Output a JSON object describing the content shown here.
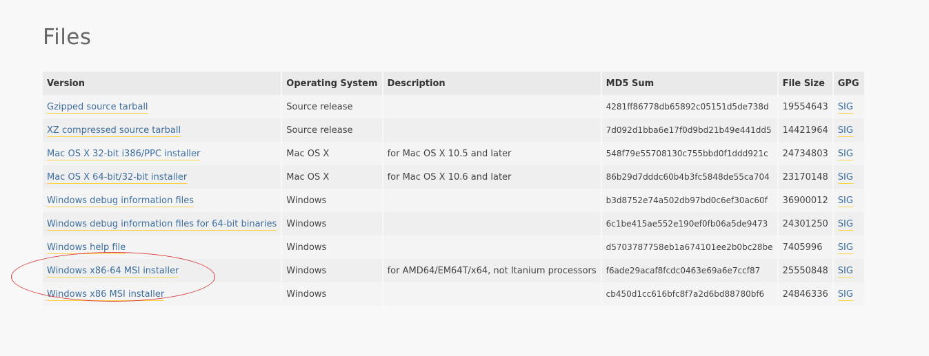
{
  "page": {
    "title": "Files"
  },
  "table": {
    "headers": {
      "version": "Version",
      "os": "Operating System",
      "description": "Description",
      "md5": "MD5 Sum",
      "size": "File Size",
      "gpg": "GPG"
    },
    "rows": [
      {
        "version": "Gzipped source tarball",
        "os": "Source release",
        "description": "",
        "md5": "4281ff86778db65892c05151d5de738d",
        "size": "19554643",
        "gpg": "SIG"
      },
      {
        "version": "XZ compressed source tarball",
        "os": "Source release",
        "description": "",
        "md5": "7d092d1bba6e17f0d9bd21b49e441dd5",
        "size": "14421964",
        "gpg": "SIG"
      },
      {
        "version": "Mac OS X 32-bit i386/PPC installer",
        "os": "Mac OS X",
        "description": "for Mac OS X 10.5 and later",
        "md5": "548f79e55708130c755bbd0f1ddd921c",
        "size": "24734803",
        "gpg": "SIG"
      },
      {
        "version": "Mac OS X 64-bit/32-bit installer",
        "os": "Mac OS X",
        "description": "for Mac OS X 10.6 and later",
        "md5": "86b29d7dddc60b4b3fc5848de55ca704",
        "size": "23170148",
        "gpg": "SIG"
      },
      {
        "version": "Windows debug information files",
        "os": "Windows",
        "description": "",
        "md5": "b3d8752e74a502db97bd0c6ef30ac60f",
        "size": "36900012",
        "gpg": "SIG"
      },
      {
        "version": "Windows debug information files for 64-bit binaries",
        "os": "Windows",
        "description": "",
        "md5": "6c1be415ae552e190ef0fb06a5de9473",
        "size": "24301250",
        "gpg": "SIG"
      },
      {
        "version": "Windows help file",
        "os": "Windows",
        "description": "",
        "md5": "d5703787758eb1a674101ee2b0bc28be",
        "size": "7405996",
        "gpg": "SIG"
      },
      {
        "version": "Windows x86-64 MSI installer",
        "os": "Windows",
        "description": "for AMD64/EM64T/x64, not Itanium processors",
        "md5": "f6ade29acaf8fcdc0463e69a6e7ccf87",
        "size": "25550848",
        "gpg": "SIG"
      },
      {
        "version": "Windows x86 MSI installer",
        "os": "Windows",
        "description": "",
        "md5": "cb450d1cc616bfc8f7a2d6bd88780bf6",
        "size": "24846336",
        "gpg": "SIG"
      }
    ]
  },
  "colors": {
    "link": "#3d6e9e",
    "link_underline": "#ffd343",
    "annotation_ellipse": "#d93a3a",
    "header_bg": "#eaeaea"
  }
}
